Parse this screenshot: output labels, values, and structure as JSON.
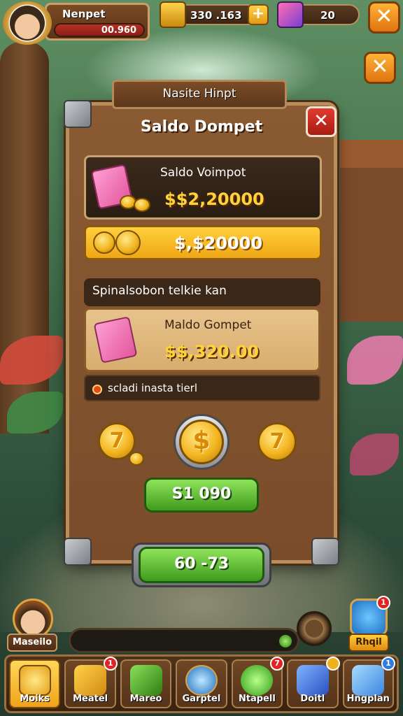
{
  "player": {
    "name": "Nenpet",
    "value": "00.960"
  },
  "resources": {
    "gold": "330 .163",
    "gems": "20"
  },
  "panel": {
    "tab_title": "Nasite Hinpt",
    "title": "Saldo Dompet",
    "balance_card": {
      "label": "Saldo Voimpot",
      "amount": "$$2,20000"
    },
    "gold_bar_amount": "$,$20000",
    "section_label": "Spinalsobon telkie kan",
    "wallet_card": {
      "label": "Maldo Gompet",
      "amount": "$$,320.00"
    },
    "info_text": "scladi inasta tierl",
    "coins": [
      "7",
      "$",
      "7"
    ],
    "action_button": "S1 090",
    "claim_button": "60 -73"
  },
  "hero": {
    "label": "Maseilo"
  },
  "side_badge": {
    "label": "Rhqil",
    "badge": "1"
  },
  "nav": [
    {
      "label": "Moiks",
      "badge": ""
    },
    {
      "label": "Meatel",
      "badge": "1"
    },
    {
      "label": "Mareo",
      "badge": ""
    },
    {
      "label": "Garptel",
      "badge": ""
    },
    {
      "label": "Ntapell",
      "badge": "7"
    },
    {
      "label": "Doitl",
      "badge": ""
    },
    {
      "label": "Hngplan",
      "badge": "1"
    }
  ]
}
